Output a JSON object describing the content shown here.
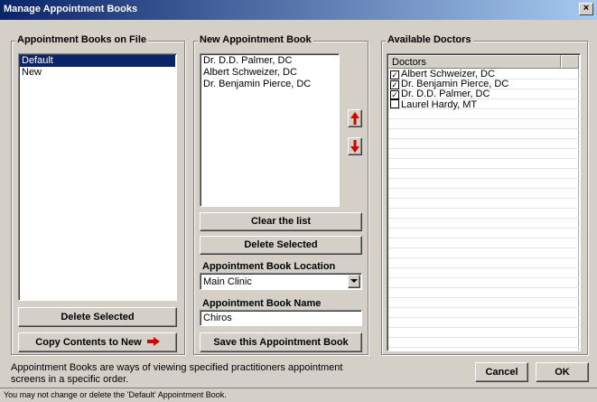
{
  "window": {
    "title": "Manage Appointment Books",
    "close_label": "×"
  },
  "left": {
    "legend": "Appointment Books on File",
    "books": [
      {
        "label": "Default",
        "selected": true
      },
      {
        "label": "New",
        "selected": false
      }
    ],
    "delete_label": "Delete Selected",
    "copy_label": "Copy Contents to New"
  },
  "middle": {
    "legend": "New Appointment Book",
    "doctors": [
      "Dr. D.D. Palmer, DC",
      "Albert Schweizer, DC",
      "Dr. Benjamin Pierce, DC"
    ],
    "clear_label": "Clear the list",
    "delete_label": "Delete Selected",
    "location_label": "Appointment Book Location",
    "location_value": "Main Clinic",
    "name_label": "Appointment Book Name",
    "name_value": "Chiros",
    "save_label": "Save this Appointment Book"
  },
  "right": {
    "legend": "Available Doctors",
    "column_header": "Doctors",
    "doctors": [
      {
        "label": "Albert Schweizer, DC",
        "checked": true
      },
      {
        "label": "Dr. Benjamin Pierce, DC",
        "checked": true
      },
      {
        "label": "Dr. D.D. Palmer, DC",
        "checked": true
      },
      {
        "label": "Laurel Hardy, MT",
        "checked": false
      }
    ]
  },
  "footer": {
    "description": "Appointment Books are ways of viewing specified practitioners appointment screens in a specific order.",
    "cancel_label": "Cancel",
    "ok_label": "OK"
  },
  "status": {
    "text": "You may not change or delete the 'Default' Appointment Book."
  },
  "colors": {
    "selection": "#0a246a",
    "arrow": "#cc0000",
    "dialog_bg": "#d4d0c8"
  }
}
